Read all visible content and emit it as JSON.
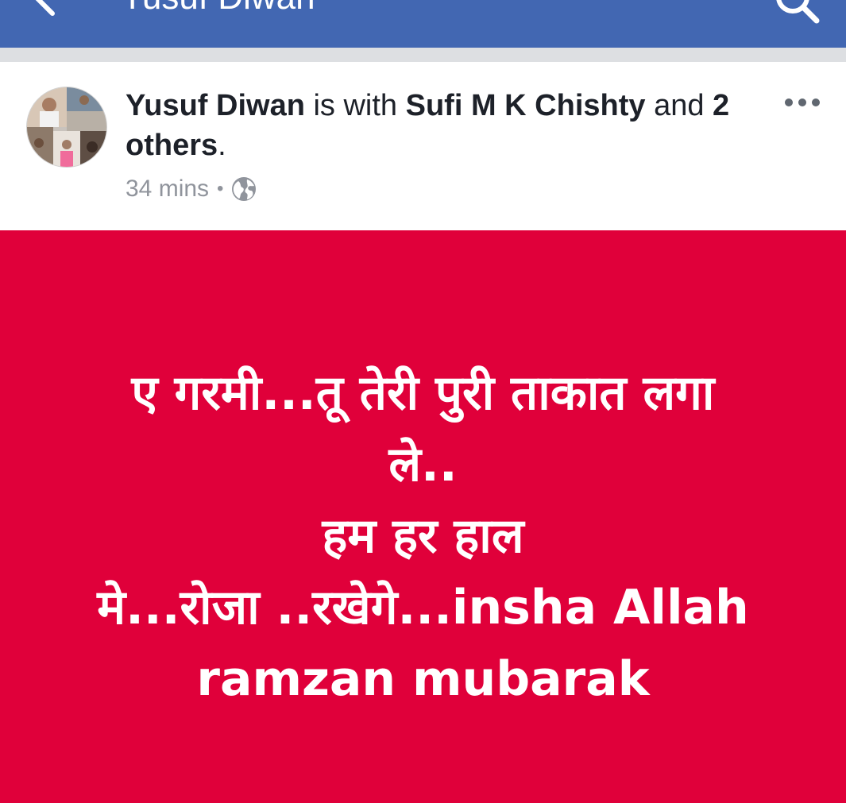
{
  "header": {
    "title": "Yusuf Diwan",
    "back_icon": "back-arrow-icon",
    "search_icon": "search-icon",
    "background_color": "#4267b2"
  },
  "post": {
    "author": "Yusuf Diwan",
    "with_text": "is with",
    "tagged_name": "Sufi M K Chishty",
    "and_text": "and",
    "others_text": "2 others",
    "period": ".",
    "time": "34 mins",
    "separator": "•",
    "privacy_icon": "globe-icon",
    "more_icon": "more-options-icon"
  },
  "card": {
    "background_color": "#e0003a",
    "lines": [
      "ए गरमी...तू तेरी पुरी ताकात लगा",
      "ले..",
      "हम हर हाल",
      "मे...रोजा ..रखेगे...insha Allah",
      "ramzan mubarak"
    ]
  }
}
